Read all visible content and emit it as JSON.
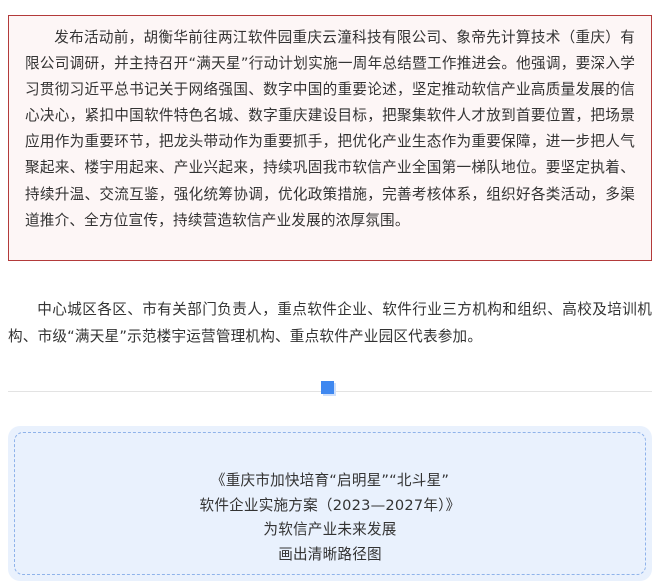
{
  "activity_box": {
    "paragraph": "发布活动前，胡衡华前往两江软件园重庆云潼科技有限公司、象帝先计算技术（重庆）有限公司调研，并主持召开“满天星”行动计划实施一周年总结暨工作推进会。他强调，要深入学习贯彻习近平总书记关于网络强国、数字中国的重要论述，坚定推动软信产业高质量发展的信心决心，紧扣中国软件特色名城、数字重庆建设目标，把聚集软件人才放到首要位置，把场景应用作为重要环节，把龙头带动作为重要抓手，把优化产业生态作为重要保障，进一步把人气聚起来、楼宇用起来、产业兴起来，持续巩固我市软信产业全国第一梯队地位。要坚定执着、持续升温、交流互鉴，强化统筹协调，优化政策措施，完善考核体系，组织好各类活动，多渠道推介、全方位宣传，持续营造软信产业发展的浓厚氛围。",
    "border_color": "#b33a3a",
    "background_color": "#fdf6f6"
  },
  "attendees": {
    "paragraph": "中心城区各区、市有关部门负责人，重点软件企业、软件行业三方机构和组织、高校及培训机构、市级“满天星”示范楼宇运营管理机构、重点软件产业园区代表参加。"
  },
  "divider": {
    "icon": "blue-square-icon",
    "accent_color": "#3f88f0"
  },
  "plan_card": {
    "lines": [
      "《重庆市加快培育“启明星”“北斗星”",
      "软件企业实施方案（2023—2027年）》",
      "为软信产业未来发展",
      "画出清晰路径图"
    ],
    "background_color": "#e9f1fd",
    "dashed_border_color": "#8fb3ea"
  }
}
